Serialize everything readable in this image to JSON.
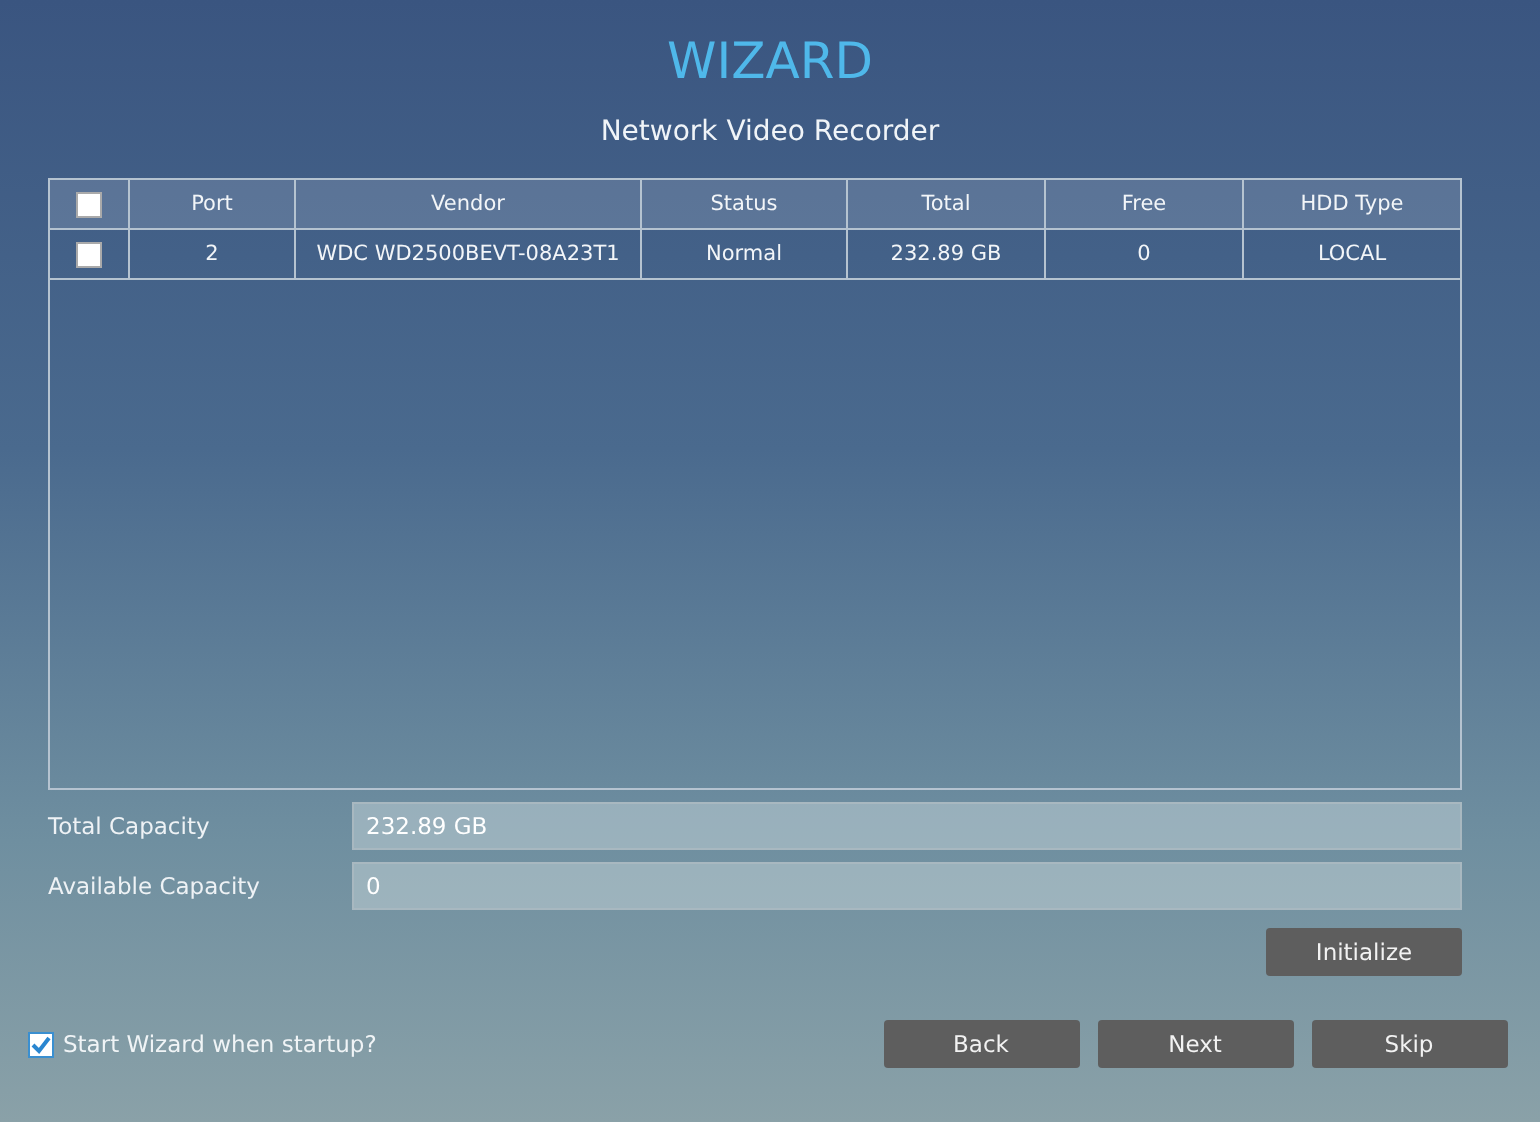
{
  "title": "WIZARD",
  "subtitle": "Network Video Recorder",
  "table": {
    "select_all": {
      "checked": false
    },
    "columns": [
      "Port",
      "Vendor",
      "Status",
      "Total",
      "Free",
      "HDD Type"
    ],
    "rows": [
      {
        "checked": false,
        "cells": [
          "2",
          "WDC WD2500BEVT-08A23T1",
          "Normal",
          "232.89 GB",
          "0",
          "LOCAL"
        ]
      }
    ]
  },
  "capacity": [
    {
      "label": "Total Capacity",
      "value": "232.89 GB"
    },
    {
      "label": "Available Capacity",
      "value": "0"
    }
  ],
  "initialize_button": "Initialize",
  "startup": {
    "label": "Start Wizard when startup?",
    "checked": true
  },
  "buttons": [
    "Back",
    "Next",
    "Skip"
  ]
}
